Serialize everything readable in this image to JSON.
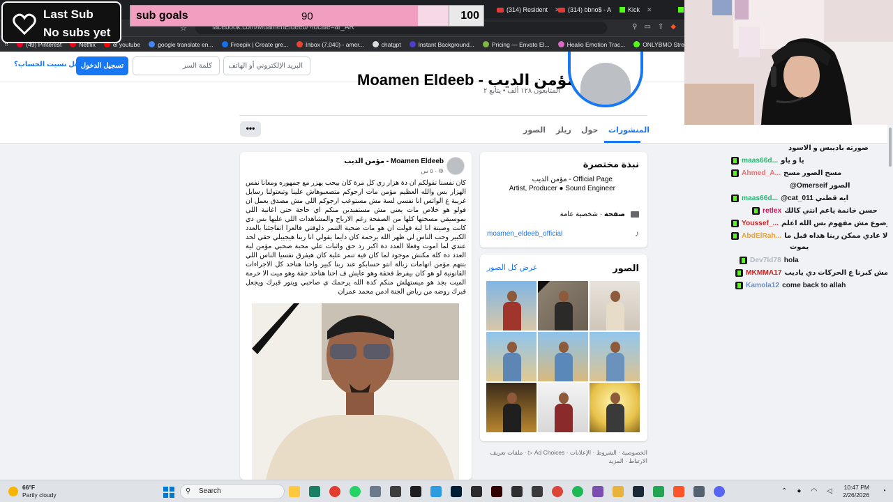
{
  "browser": {
    "tabs": [
      {
        "label": "(314) Resident",
        "type": "youtube"
      },
      {
        "label": "(314) bbno$ - A",
        "type": "youtube"
      },
      {
        "label": "Kick",
        "type": "kick"
      }
    ],
    "url": "facebook.com/MoamenEldeeb/?locale=ar_AR",
    "bookmarks": [
      "(49) Pinterest",
      "Netflix",
      "el youtube",
      "google translate en...",
      "Freepik | Create gre...",
      "Inbox (7,040) - amer...",
      "chatgpt",
      "Instant Background...",
      "Pricing — Envato El...",
      "Healio Emotion Trac...",
      "ONLYBMO Stream -..."
    ]
  },
  "fb_header": {
    "forgot": "هل نسيت الحساب؟",
    "login": "تسجيل الدخول",
    "password_placeholder": "كلمة السر",
    "email_placeholder": "البريد الإلكتروني أو الهاتف"
  },
  "profile": {
    "name": "Moamen Eldeeb - مؤمن الديب",
    "followers": "المتابعون ١٢٨ ألف • يتابع ٢",
    "tabs": [
      "المنشورات",
      "حول",
      "ريلز",
      "الصور"
    ],
    "more": "•••"
  },
  "intro": {
    "title": "نبذة مختصرة",
    "line1": "مؤمن الديب - Official Page",
    "line2": "Artist, Producer ● Sound Engineer",
    "category_bold": "صفحة",
    "category_rest": " · شخصية عامة",
    "instagram": "moamen_eldeeb_official"
  },
  "photos_card": {
    "title": "الصور",
    "see_all": "عرض كل الصور"
  },
  "footer_links": "الخصوصية · الشروط · الإعلانات · Ad Choices ▷ · ملفات تعريف الارتباط · المزيد",
  "post": {
    "author": "مؤمن الديب - Moamen Eldeeb",
    "meta": "٥ س · ⚙",
    "text": "كان نفسنا نقولكم ان دة هزار زي كل مرة كان بيحب يهزر مع جمهوره ومعانا نفس الهزار بس والله العظيم مؤمن مات ارجوكم متصعبوهاش علينا وتبعتولنا رسايل غريبة ع الواتس انا نفسي لسة مش مستوعب ارجوكم اللي مش مصدق يعمل ان فولو هو خلاص مات يعني مش مستفيدين منكم اي حاجة حتي اغانية اللي بموسيقي مسحتها كلها من الصفحة رغم الارباح والمشاهدات اللي عليها بس دي كانت وصيتة انا لية قولت ان هو مات ضحية التنمر دلوقتي فالعزا اتفاجئنا بالعدد الكبير وحب الناس لي ظهر الله يرحمة كان دايما يقولي انا ربنا هيجيبلي حقي لحد عندي لما اموت وفعلا العدد دة اكبر رد حق واثبات علي محبة صحبي مؤمن لية العدد دة كلة مكنش موجود لما كان فية تنمر علية كان هيفرق نفسيا الناس اللي بتتهم مؤمن اتهامات زبالة انتو حسابكو عند ربنا كبير واحنا هناخد كل الاجراءات القانونية لو هو كان بيفرط فحقة وهو عايش ف احنا هناخد حقة وهو ميت الا حرمة الميت بجد هو ميستهلش منكم كدة الله يرحمك ي صاحبي وينور قبرك ويجعل قبرك روضه من رياض الجنة ادمن محمد عمران"
  },
  "overlay": {
    "last_sub_title": "Last Sub",
    "last_sub_value": "No subs yet",
    "goal_label": "sub goals",
    "goal_current": "90",
    "goal_target": "100",
    "goal_fraction": 0.9
  },
  "chat": [
    {
      "user": "",
      "text": "صورته باديبس و الاسود",
      "color": "#1b1b1b"
    },
    {
      "user": "maas66d...",
      "text": "يا و ياو",
      "color": "#2bb673",
      "badge": true
    },
    {
      "user": "Ahmed_A...",
      "text": "مسح الصور مسح",
      "color": "#e57373",
      "badge": true
    },
    {
      "user": "",
      "text": "@Omerseif الصور",
      "color": "#1b1b1b"
    },
    {
      "user": "maas66d...",
      "text": "@cat_011 ايه قطني",
      "color": "#2bb673",
      "badge": true
    },
    {
      "user": "retlex",
      "text": "حسن خاتمة ياعم انتي كالك",
      "color": "#c2185b",
      "badge": true
    },
    {
      "user": "Youssef_...",
      "text": "موضوع مش مفهوم بس الله اعلم",
      "color": "#c62828",
      "badge": true
    },
    {
      "user": "AbdElRah...",
      "text": "لا عادي ممكن ربنا هداه قبل ما",
      "color": "#e6a23c",
      "badge": true
    },
    {
      "user": "",
      "text": "يموت",
      "color": "#1b1b1b"
    },
    {
      "user": "Dev7ld78",
      "text": "hola",
      "color": "#b0b8c8",
      "badge": true
    },
    {
      "user": "MKMMA17",
      "text": "مش كبرنا ع الحركات دي ياديب",
      "color": "#c62828",
      "badge": true
    },
    {
      "user": "Kamola12",
      "text": "come back to allah",
      "color": "#6b8fc8",
      "badge": true
    }
  ],
  "taskbar": {
    "temp": "66°F",
    "weather": "Partly cloudy",
    "search": "Search",
    "time": "10:47 PM",
    "date": "2/26/2026"
  }
}
